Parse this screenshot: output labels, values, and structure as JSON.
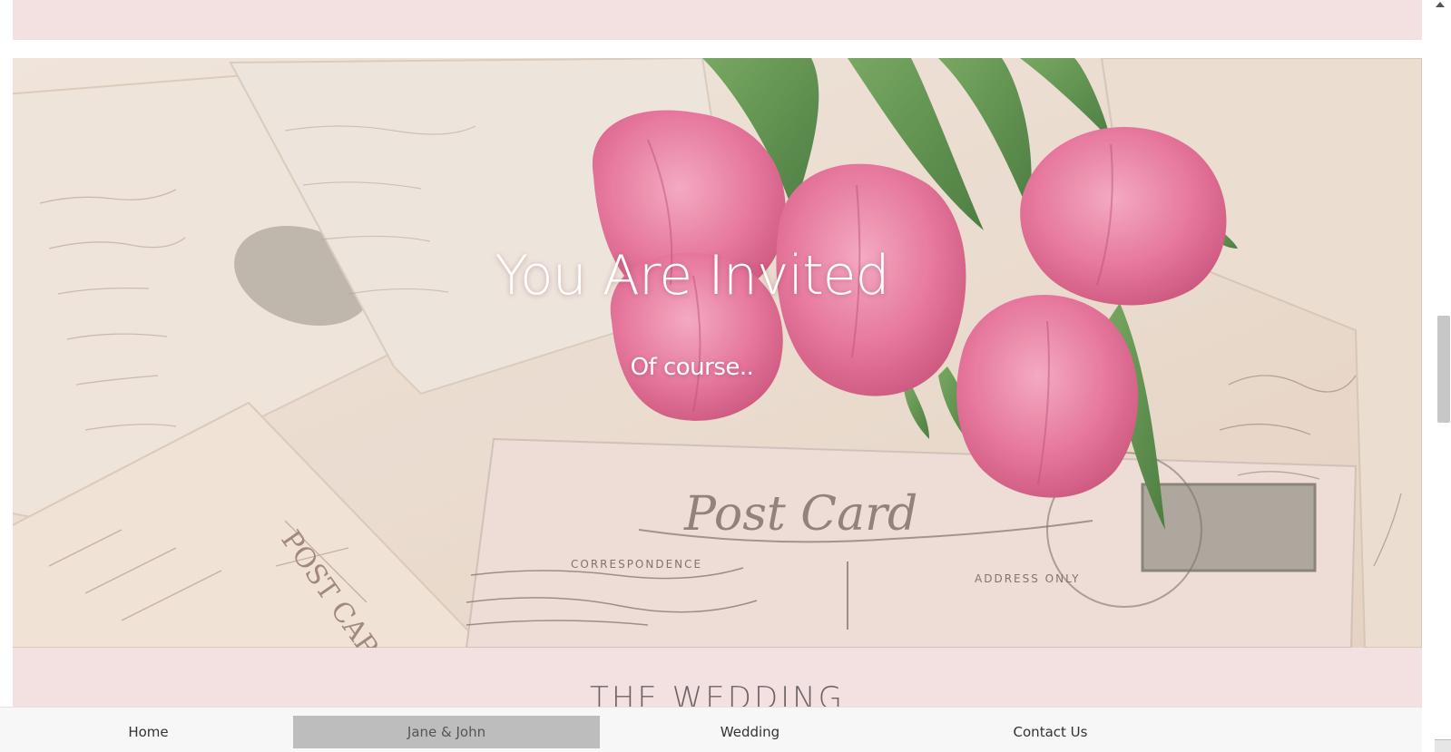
{
  "hero": {
    "title": "You Are Invited",
    "subtitle": "Of course.."
  },
  "section": {
    "heading": "THE WEDDING"
  },
  "nav": {
    "items": [
      {
        "label": "Home",
        "active": false
      },
      {
        "label": "Jane & John",
        "active": true
      },
      {
        "label": "Wedding",
        "active": false
      },
      {
        "label": "Contact Us",
        "active": false
      }
    ]
  },
  "colors": {
    "band_pink": "#f3e1e2",
    "nav_background": "#f7f7f7",
    "nav_active": "#bdbdbd",
    "tulip_pink": "#e06b92",
    "leaf_green": "#4e8a3c"
  },
  "icons": {
    "scroll_up": "chevron-up-icon",
    "scroll_down": "chevron-down-icon"
  }
}
